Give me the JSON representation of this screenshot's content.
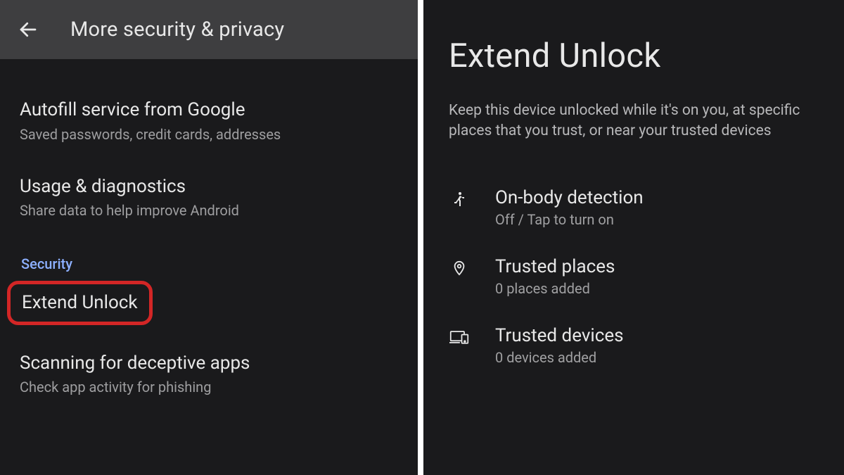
{
  "left": {
    "appbar": {
      "title": "More security & privacy"
    },
    "items": [
      {
        "title": "Autofill service from Google",
        "subtitle": "Saved passwords, credit cards, addresses"
      },
      {
        "title": "Usage & diagnostics",
        "subtitle": "Share data to help improve Android"
      }
    ],
    "section_label": "Security",
    "highlighted": {
      "title": "Extend Unlock"
    },
    "after_items": [
      {
        "title": "Scanning for deceptive apps",
        "subtitle": "Check app activity for phishing"
      }
    ]
  },
  "right": {
    "title": "Extend Unlock",
    "description": "Keep this device unlocked while it's on you, at specific places that you trust, or near your trusted devices",
    "options": [
      {
        "icon": "walk",
        "title": "On-body detection",
        "subtitle": "Off / Tap to turn on"
      },
      {
        "icon": "pin",
        "title": "Trusted places",
        "subtitle": "0 places added"
      },
      {
        "icon": "devices",
        "title": "Trusted devices",
        "subtitle": "0 devices added"
      }
    ]
  }
}
